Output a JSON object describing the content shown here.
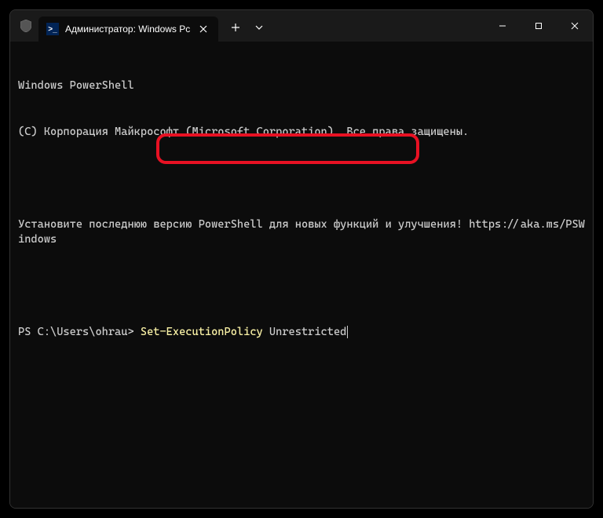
{
  "titlebar": {
    "tab_title": "Администратор: Windows Pc",
    "tab_icon_text": ">_"
  },
  "terminal": {
    "line1": "Windows PowerShell",
    "line2": "(C) Корпорация Майкрософт (Microsoft Corporation). Все права защищены.",
    "line3": "Установите последнюю версию PowerShell для новых функций и улучшения! https://aka.ms/PSWindows",
    "prompt": "PS C:\\Users\\ohrau> ",
    "cmd_part1": "Set-ExecutionPolicy ",
    "cmd_part2": "Unrestricted"
  }
}
